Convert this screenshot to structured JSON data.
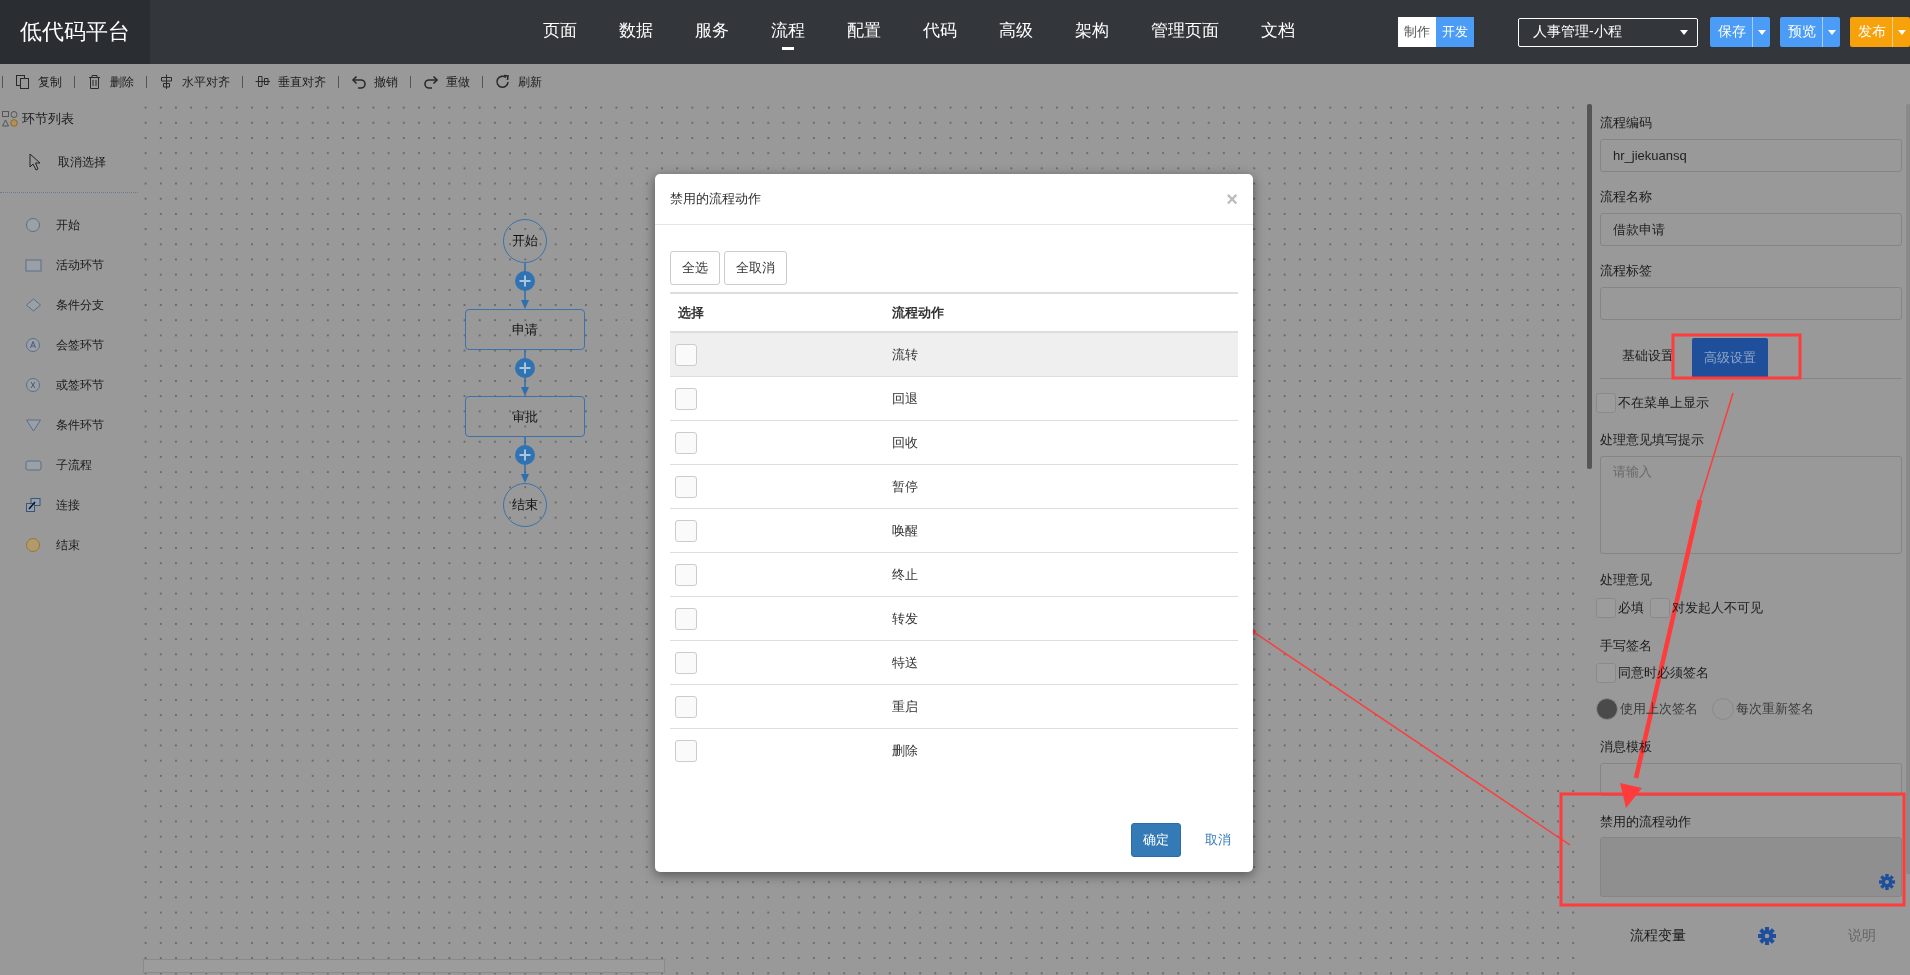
{
  "app": {
    "title": "低代码平台"
  },
  "nav": [
    {
      "label": "页面",
      "selected": false
    },
    {
      "label": "数据",
      "selected": false
    },
    {
      "label": "服务",
      "selected": false
    },
    {
      "label": "流程",
      "selected": true
    },
    {
      "label": "配置",
      "selected": false
    },
    {
      "label": "代码",
      "selected": false
    },
    {
      "label": "高级",
      "selected": false
    },
    {
      "label": "架构",
      "selected": false
    },
    {
      "label": "管理页面",
      "selected": false
    },
    {
      "label": "文档",
      "selected": false
    }
  ],
  "mode_toggle": [
    {
      "label": "制作",
      "selected": false
    },
    {
      "label": "开发",
      "selected": true
    }
  ],
  "app_select": {
    "value": "人事管理-小程"
  },
  "header_buttons": [
    {
      "label": "保存",
      "color": "#4a9cf6"
    },
    {
      "label": "预览",
      "color": "#4a9cf6"
    },
    {
      "label": "发布",
      "color": "#f7a10b"
    }
  ],
  "toolbar": [
    {
      "label": "复制",
      "kind": "copy"
    },
    {
      "label": "删除",
      "kind": "delete"
    },
    {
      "label": "水平对齐",
      "kind": "align-h"
    },
    {
      "label": "垂直对齐",
      "kind": "align-v"
    },
    {
      "label": "撤销",
      "kind": "undo"
    },
    {
      "label": "重做",
      "kind": "redo"
    },
    {
      "label": "刷新",
      "kind": "refresh"
    }
  ],
  "sidebar": {
    "title": "环节列表",
    "deselect": "取消选择",
    "items": [
      {
        "label": "开始",
        "kind": "start"
      },
      {
        "label": "活动环节",
        "kind": "activity"
      },
      {
        "label": "条件分支",
        "kind": "branch"
      },
      {
        "label": "会签环节",
        "kind": "countersign"
      },
      {
        "label": "或签环节",
        "kind": "orsign"
      },
      {
        "label": "条件环节",
        "kind": "condition"
      },
      {
        "label": "子流程",
        "kind": "subprocess"
      },
      {
        "label": "连接",
        "kind": "connect"
      },
      {
        "label": "结束",
        "kind": "end"
      }
    ]
  },
  "canvas": {
    "nodes": [
      {
        "label": "开始",
        "kind": "start"
      },
      {
        "label": "申请",
        "kind": "task"
      },
      {
        "label": "审批",
        "kind": "task"
      },
      {
        "label": "结束",
        "kind": "end"
      }
    ]
  },
  "properties": {
    "fields": [
      {
        "label": "流程编码",
        "value": "hr_jiekuansq"
      },
      {
        "label": "流程名称",
        "value": "借款申请"
      },
      {
        "label": "流程标签"
      }
    ],
    "tabs": [
      {
        "label": "基础设置",
        "selected": false
      },
      {
        "label": "高级设置",
        "selected": true
      }
    ],
    "hide_in_menu": {
      "label": "不在菜单上显示",
      "checked": false
    },
    "opinion_hint": {
      "label": "处理意见填写提示",
      "placeholder": "请输入"
    },
    "opinion": {
      "label": "处理意见",
      "options": [
        {
          "label": "必填",
          "checked": false
        },
        {
          "label": "对发起人不可见",
          "checked": false
        }
      ]
    },
    "signature": {
      "label": "手写签名",
      "required": {
        "label": "同意时必须签名",
        "checked": false
      },
      "modes": [
        {
          "label": "使用上次签名",
          "selected": true
        },
        {
          "label": "每次重新签名",
          "selected": false
        }
      ]
    },
    "message_template": {
      "label": "消息模板"
    },
    "disabled_actions": {
      "label": "禁用的流程动作"
    },
    "footer": {
      "variables": "流程变量",
      "help": "说明"
    }
  },
  "modal": {
    "title": "禁用的流程动作",
    "close": "×",
    "select_all": "全选",
    "deselect_all": "全取消",
    "columns": [
      "选择",
      "流程动作"
    ],
    "rows": [
      {
        "action": "流转",
        "checked": false,
        "highlighted": true
      },
      {
        "action": "回退",
        "checked": false,
        "highlighted": false
      },
      {
        "action": "回收",
        "checked": false,
        "highlighted": false
      },
      {
        "action": "暂停",
        "checked": false,
        "highlighted": false
      },
      {
        "action": "唤醒",
        "checked": false,
        "highlighted": false
      },
      {
        "action": "终止",
        "checked": false,
        "highlighted": false
      },
      {
        "action": "转发",
        "checked": false,
        "highlighted": false
      },
      {
        "action": "特送",
        "checked": false,
        "highlighted": false
      },
      {
        "action": "重启",
        "checked": false,
        "highlighted": false
      },
      {
        "action": "删除",
        "checked": false,
        "highlighted": false
      }
    ],
    "confirm": "确定",
    "cancel": "取消"
  }
}
